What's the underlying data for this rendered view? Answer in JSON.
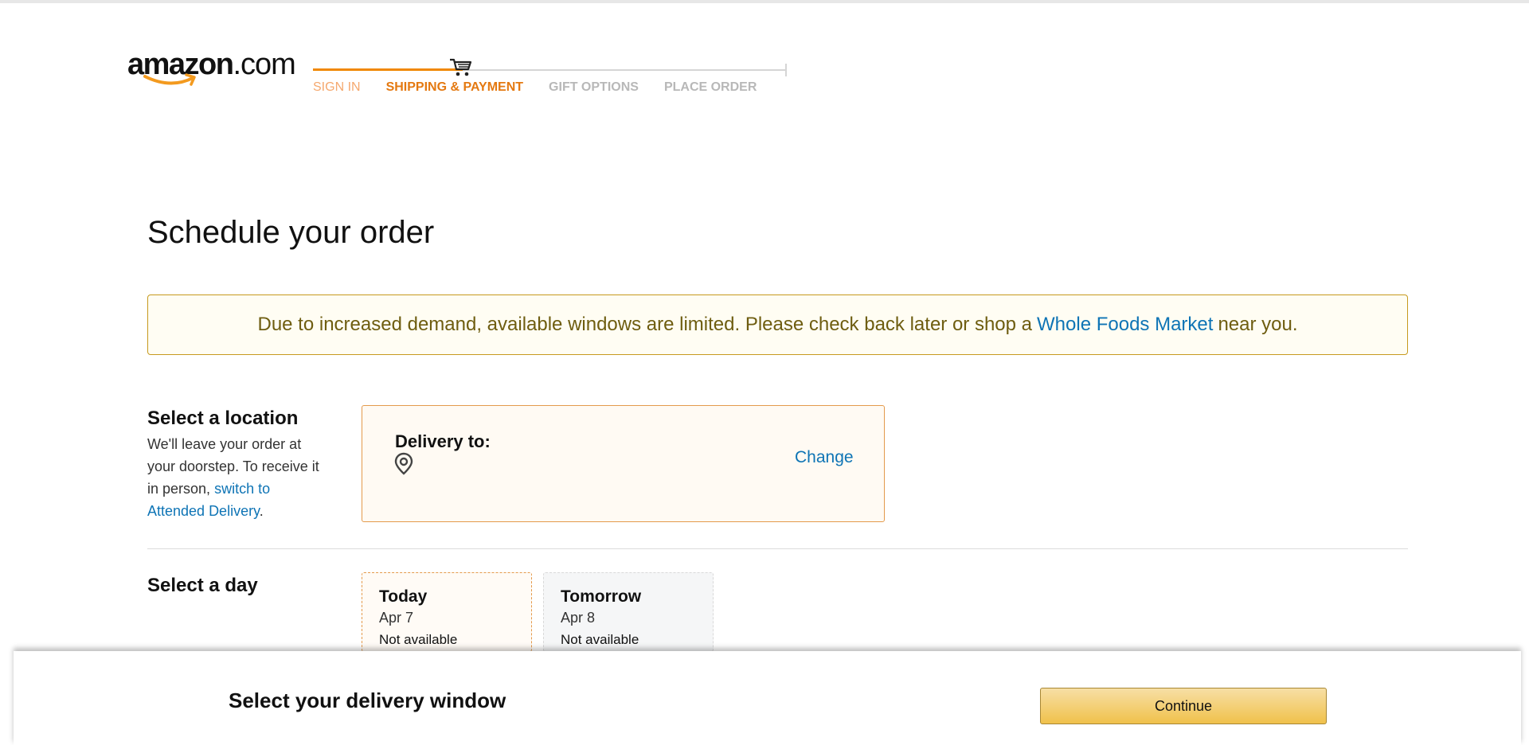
{
  "header": {
    "logo_text": "amazon",
    "logo_suffix": ".com",
    "steps": [
      {
        "label": "SIGN IN",
        "state": "done"
      },
      {
        "label": "SHIPPING & PAYMENT",
        "state": "active"
      },
      {
        "label": "GIFT OPTIONS",
        "state": "pending"
      },
      {
        "label": "PLACE ORDER",
        "state": "pending"
      }
    ]
  },
  "main": {
    "title": "Schedule your order",
    "alert": {
      "text_before": "Due to increased demand, available windows are limited. Please check back later or shop a",
      "link": "Whole Foods Market",
      "text_after": "near you."
    },
    "location": {
      "label": "Select a location",
      "desc_before": "We'll leave your order at your doorstep. To receive it in person,",
      "desc_link": "switch to Attended Delivery",
      "desc_after": ".",
      "card_title": "Delivery to:",
      "change_label": "Change"
    },
    "day": {
      "label": "Select a day",
      "days": [
        {
          "name": "Today",
          "date": "Apr 7",
          "status": "Not available",
          "selected": true
        },
        {
          "name": "Tomorrow",
          "date": "Apr 8",
          "status": "Not available",
          "selected": false
        }
      ]
    }
  },
  "footer_bar": {
    "label": "Select your delivery window",
    "continue_label": "Continue"
  },
  "colors": {
    "accent_orange": "#e47911",
    "link_blue": "#0e74b5",
    "alert_border": "#c79a1e",
    "button_yellow": "#f0c14b"
  }
}
